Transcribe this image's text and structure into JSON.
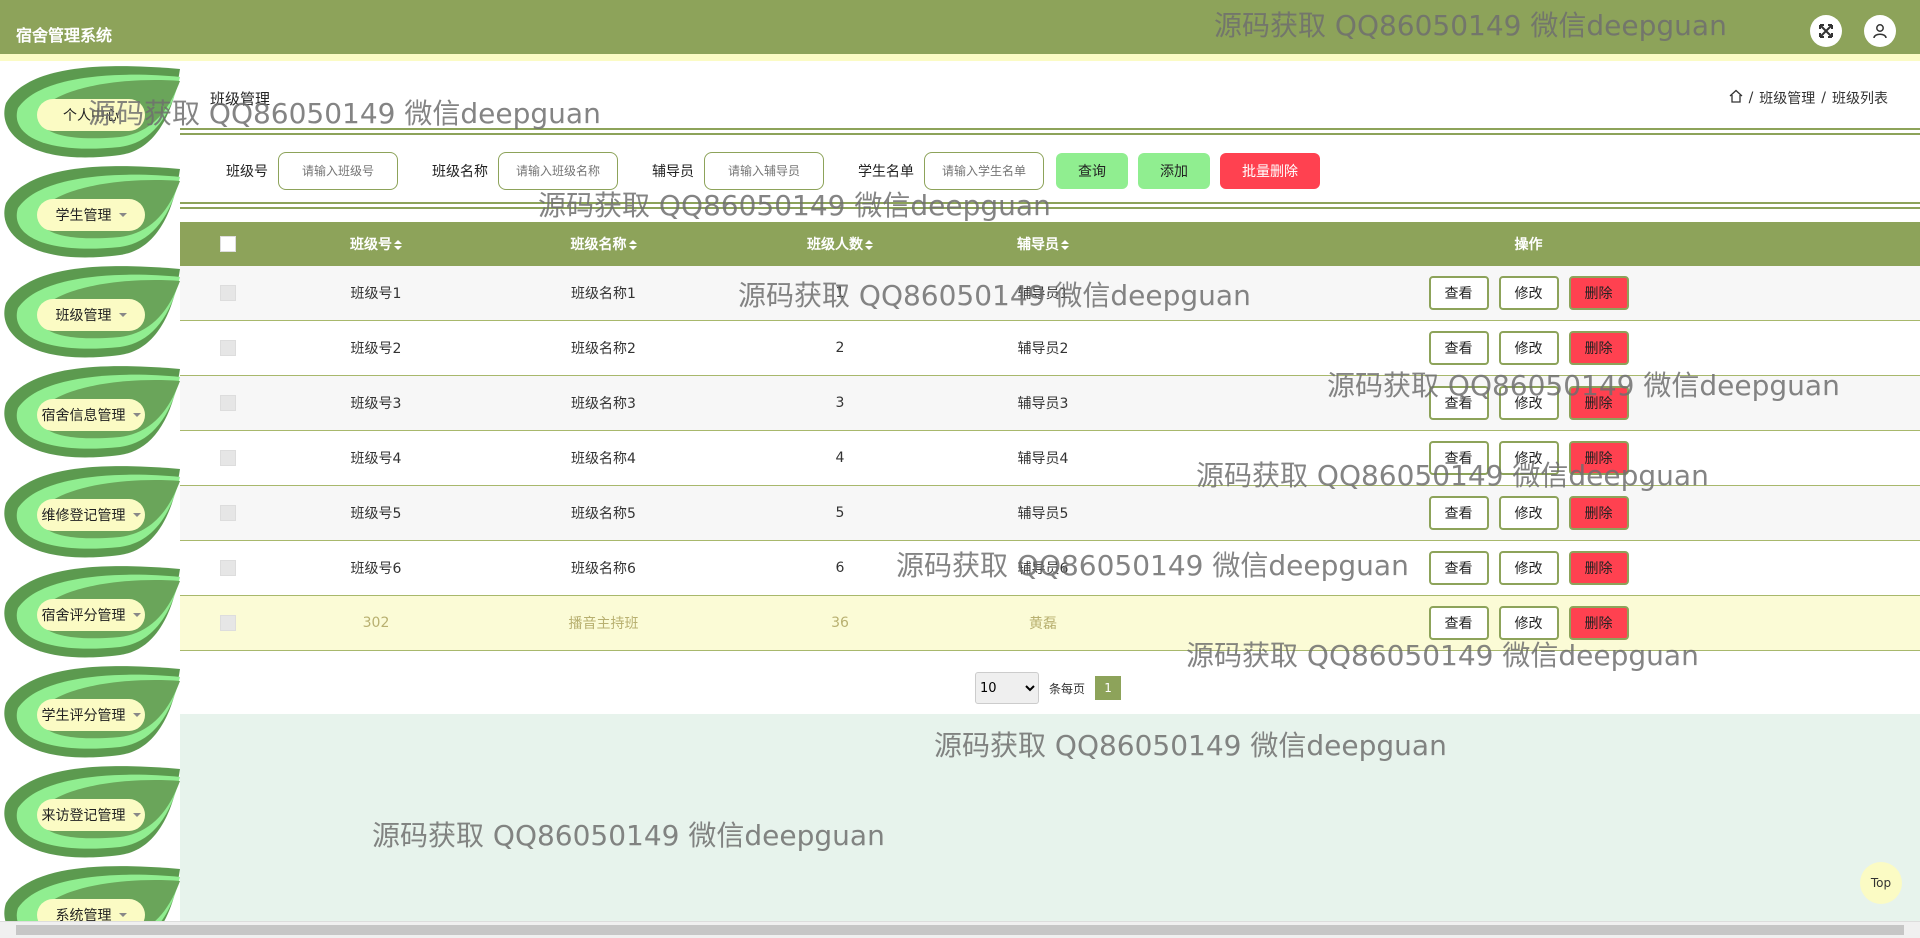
{
  "app": {
    "title": "宿舍管理系统"
  },
  "sidebar": {
    "items": [
      {
        "label": "个人中心",
        "has_caret": false
      },
      {
        "label": "学生管理",
        "has_caret": true
      },
      {
        "label": "班级管理",
        "has_caret": true
      },
      {
        "label": "宿舍信息管理",
        "has_caret": true
      },
      {
        "label": "维修登记管理",
        "has_caret": true
      },
      {
        "label": "宿舍评分管理",
        "has_caret": true
      },
      {
        "label": "学生评分管理",
        "has_caret": true
      },
      {
        "label": "来访登记管理",
        "has_caret": true
      },
      {
        "label": "系统管理",
        "has_caret": true
      }
    ]
  },
  "page": {
    "title": "班级管理",
    "breadcrumb": [
      "班级管理",
      "班级列表"
    ]
  },
  "search": {
    "fields": [
      {
        "label": "班级号",
        "placeholder": "请输入班级号"
      },
      {
        "label": "班级名称",
        "placeholder": "请输入班级名称"
      },
      {
        "label": "辅导员",
        "placeholder": "请输入辅导员"
      },
      {
        "label": "学生名单",
        "placeholder": "请输入学生名单"
      }
    ],
    "query_label": "查询",
    "add_label": "添加",
    "batch_delete_label": "批量删除"
  },
  "table": {
    "headers": {
      "class_no": "班级号",
      "class_name": "班级名称",
      "count": "班级人数",
      "tutor": "辅导员",
      "ops": "操作"
    },
    "actions": {
      "view": "查看",
      "edit": "修改",
      "delete": "删除"
    },
    "rows": [
      {
        "class_no": "班级号1",
        "class_name": "班级名称1",
        "count": "1",
        "tutor": "辅导员1"
      },
      {
        "class_no": "班级号2",
        "class_name": "班级名称2",
        "count": "2",
        "tutor": "辅导员2"
      },
      {
        "class_no": "班级号3",
        "class_name": "班级名称3",
        "count": "3",
        "tutor": "辅导员3"
      },
      {
        "class_no": "班级号4",
        "class_name": "班级名称4",
        "count": "4",
        "tutor": "辅导员4"
      },
      {
        "class_no": "班级号5",
        "class_name": "班级名称5",
        "count": "5",
        "tutor": "辅导员5"
      },
      {
        "class_no": "班级号6",
        "class_name": "班级名称6",
        "count": "6",
        "tutor": "辅导员6"
      },
      {
        "class_no": "302",
        "class_name": "播音主持班",
        "count": "36",
        "tutor": "黄磊"
      }
    ]
  },
  "pagination": {
    "page_size": "10",
    "per_page_label": "条每页",
    "current_page": "1"
  },
  "top_button": "Top",
  "watermark": "源码获取 QQ86050149 微信deepguan",
  "colors": {
    "primary": "#8da35a",
    "accent_yellow": "#fbfbc4",
    "green_button": "#90ee90",
    "danger": "#ff4150",
    "bottom_area": "#e7f3ec"
  }
}
